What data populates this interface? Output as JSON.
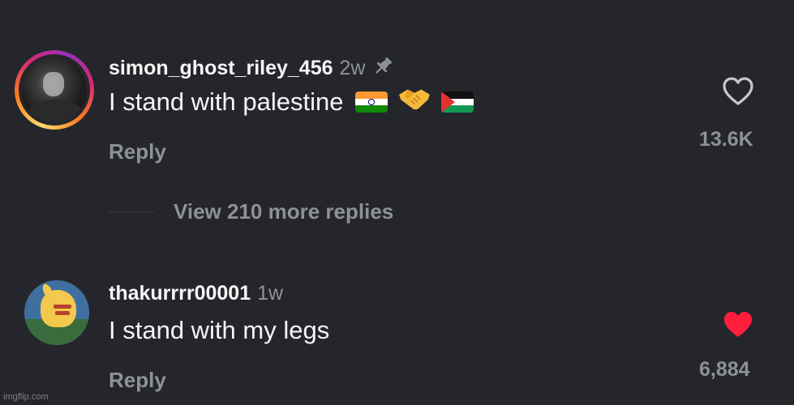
{
  "comments": [
    {
      "username": "simon_ghost_riley_456",
      "time": "2w",
      "pinned": true,
      "text": "I stand with palestine",
      "emojis": [
        "india-flag",
        "handshake",
        "palestine-flag"
      ],
      "reply_label": "Reply",
      "like_count": "13.6K",
      "liked": false,
      "has_story_ring": true
    },
    {
      "username": "thakurrrr00001",
      "time": "1w",
      "text": "I stand with my legs",
      "reply_label": "Reply",
      "like_count": "6,884",
      "liked": true,
      "has_story_ring": false
    }
  ],
  "view_replies_label": "View 210 more replies",
  "watermark": "imgflip.com",
  "colors": {
    "background": "#24262b",
    "text_primary": "#f5f5f5",
    "text_secondary": "#8e9196",
    "like_active": "#ff1f3d"
  }
}
